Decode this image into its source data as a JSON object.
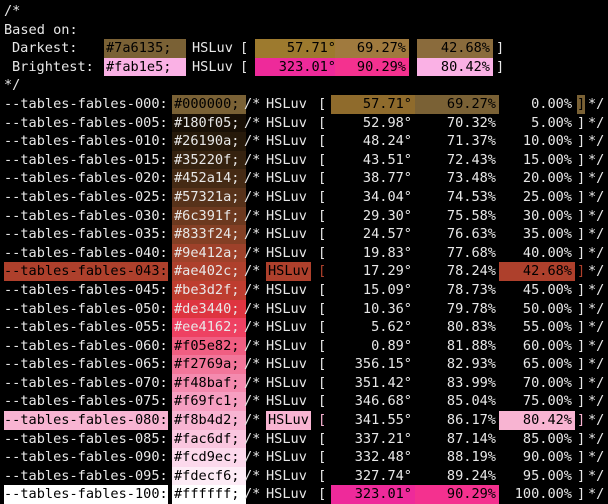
{
  "header": {
    "comment_open": "/*",
    "based_on": "Based on:",
    "darkest": {
      "label": "Darkest:",
      "hex": "#7a6135;",
      "hsluv": "HSLuv",
      "open": "[",
      "h": "57.71°",
      "s": "69.27%",
      "l": "42.68%",
      "close": "]",
      "color": "#7a6135",
      "text_color": "#000000"
    },
    "brightest": {
      "label": "Brightest:",
      "hex": "#fab1e5;",
      "hsluv": "HSLuv",
      "open": "[",
      "h": "323.01°",
      "s": "90.29%",
      "l": "80.42%",
      "close": "]",
      "color": "#fab1e5",
      "text_color": "#000000"
    },
    "comment_close": "*/"
  },
  "hsl_swatches": {
    "h_base": "#9d7a2e",
    "s_base": "#a07a3e",
    "l_base": "#8a6b3c",
    "h_bright": "#ee2a9a",
    "s_bright": "#f4318f",
    "l_bright": "#fab1e5"
  },
  "rows": [
    {
      "name": "--tables-fables-000:",
      "hex": "#000000;",
      "open": "/*",
      "hsluv": "HSLuv",
      "lb": "[",
      "h": "57.71°",
      "s": "69.27%",
      "l": "0.00%",
      "rb": "]",
      "end": "*/",
      "color": "#000000",
      "name_hl": "#000000",
      "name_fg": "#e8e8e8",
      "hsluv_hl": "",
      "boxed": true,
      "hex_bg": "#7a6135"
    },
    {
      "name": "--tables-fables-005:",
      "hex": "#180f05;",
      "open": "/*",
      "hsluv": "HSLuv",
      "lb": "[",
      "h": "52.98°",
      "s": "70.32%",
      "l": "5.00%",
      "rb": "]",
      "end": "*/",
      "color": "#180f05",
      "name_hl": "",
      "name_fg": "#e8e8e8",
      "hsluv_hl": ""
    },
    {
      "name": "--tables-fables-010:",
      "hex": "#26190a;",
      "open": "/*",
      "hsluv": "HSLuv",
      "lb": "[",
      "h": "48.24°",
      "s": "71.37%",
      "l": "10.00%",
      "rb": "]",
      "end": "*/",
      "color": "#26190a",
      "name_hl": "",
      "name_fg": "#e8e8e8",
      "hsluv_hl": ""
    },
    {
      "name": "--tables-fables-015:",
      "hex": "#35220f;",
      "open": "/*",
      "hsluv": "HSLuv",
      "lb": "[",
      "h": "43.51°",
      "s": "72.43%",
      "l": "15.00%",
      "rb": "]",
      "end": "*/",
      "color": "#35220f",
      "name_hl": "",
      "name_fg": "#e8e8e8",
      "hsluv_hl": ""
    },
    {
      "name": "--tables-fables-020:",
      "hex": "#452a14;",
      "open": "/*",
      "hsluv": "HSLuv",
      "lb": "[",
      "h": "38.77°",
      "s": "73.48%",
      "l": "20.00%",
      "rb": "]",
      "end": "*/",
      "color": "#452a14",
      "name_hl": "",
      "name_fg": "#e8e8e8",
      "hsluv_hl": ""
    },
    {
      "name": "--tables-fables-025:",
      "hex": "#57321a;",
      "open": "/*",
      "hsluv": "HSLuv",
      "lb": "[",
      "h": "34.04°",
      "s": "74.53%",
      "l": "25.00%",
      "rb": "]",
      "end": "*/",
      "color": "#57321a",
      "name_hl": "",
      "name_fg": "#e8e8e8",
      "hsluv_hl": ""
    },
    {
      "name": "--tables-fables-030:",
      "hex": "#6c391f;",
      "open": "/*",
      "hsluv": "HSLuv",
      "lb": "[",
      "h": "29.30°",
      "s": "75.58%",
      "l": "30.00%",
      "rb": "]",
      "end": "*/",
      "color": "#6c391f",
      "name_hl": "",
      "name_fg": "#e8e8e8",
      "hsluv_hl": ""
    },
    {
      "name": "--tables-fables-035:",
      "hex": "#833f24;",
      "open": "/*",
      "hsluv": "HSLuv",
      "lb": "[",
      "h": "24.57°",
      "s": "76.63%",
      "l": "35.00%",
      "rb": "]",
      "end": "*/",
      "color": "#833f24",
      "name_hl": "",
      "name_fg": "#e8e8e8",
      "hsluv_hl": ""
    },
    {
      "name": "--tables-fables-040:",
      "hex": "#9e412a;",
      "open": "/*",
      "hsluv": "HSLuv",
      "lb": "[",
      "h": "19.83°",
      "s": "77.68%",
      "l": "40.00%",
      "rb": "]",
      "end": "*/",
      "color": "#9e412a",
      "name_hl": "",
      "name_fg": "#e8e8e8",
      "hsluv_hl": ""
    },
    {
      "name": "--tables-fables-043:",
      "hex": "#ae402c;",
      "open": "/*",
      "hsluv": "HSLuv",
      "lb": "[",
      "h": "17.29°",
      "s": "78.24%",
      "l": "42.68%",
      "rb": "]",
      "end": "*/",
      "color": "#ae402c",
      "name_hl": "#ae402c",
      "name_fg": "#000000",
      "hsluv_hl": "#ae402c",
      "l_hl": "#ae402c",
      "rb_hl": "#ae402c"
    },
    {
      "name": "--tables-fables-045:",
      "hex": "#be3d2f;",
      "open": "/*",
      "hsluv": "HSLuv",
      "lb": "[",
      "h": "15.09°",
      "s": "78.73%",
      "l": "45.00%",
      "rb": "]",
      "end": "*/",
      "color": "#be3d2f",
      "name_hl": "",
      "name_fg": "#e8e8e8",
      "hsluv_hl": ""
    },
    {
      "name": "--tables-fables-050:",
      "hex": "#de3440;",
      "open": "/*",
      "hsluv": "HSLuv",
      "lb": "[",
      "h": "10.36°",
      "s": "79.78%",
      "l": "50.00%",
      "rb": "]",
      "end": "*/",
      "color": "#de3440",
      "name_hl": "",
      "name_fg": "#e8e8e8",
      "hsluv_hl": ""
    },
    {
      "name": "--tables-fables-055:",
      "hex": "#ee4162;",
      "open": "/*",
      "hsluv": "HSLuv",
      "lb": "[",
      "h": "5.62°",
      "s": "80.83%",
      "l": "55.00%",
      "rb": "]",
      "end": "*/",
      "color": "#ee4162",
      "name_hl": "",
      "name_fg": "#e8e8e8",
      "hsluv_hl": ""
    },
    {
      "name": "--tables-fables-060:",
      "hex": "#f05e82;",
      "open": "/*",
      "hsluv": "HSLuv",
      "lb": "[",
      "h": "0.89°",
      "s": "81.88%",
      "l": "60.00%",
      "rb": "]",
      "end": "*/",
      "color": "#f05e82",
      "name_hl": "",
      "name_fg": "#e8e8e8",
      "hsluv_hl": ""
    },
    {
      "name": "--tables-fables-065:",
      "hex": "#f2769a;",
      "open": "/*",
      "hsluv": "HSLuv",
      "lb": "[",
      "h": "356.15°",
      "s": "82.93%",
      "l": "65.00%",
      "rb": "]",
      "end": "*/",
      "color": "#f2769a",
      "name_hl": "",
      "name_fg": "#e8e8e8",
      "hsluv_hl": ""
    },
    {
      "name": "--tables-fables-070:",
      "hex": "#f48baf;",
      "open": "/*",
      "hsluv": "HSLuv",
      "lb": "[",
      "h": "351.42°",
      "s": "83.99%",
      "l": "70.00%",
      "rb": "]",
      "end": "*/",
      "color": "#f48baf",
      "name_hl": "",
      "name_fg": "#e8e8e8",
      "hsluv_hl": ""
    },
    {
      "name": "--tables-fables-075:",
      "hex": "#f69fc1;",
      "open": "/*",
      "hsluv": "HSLuv",
      "lb": "[",
      "h": "346.68°",
      "s": "85.04%",
      "l": "75.00%",
      "rb": "]",
      "end": "*/",
      "color": "#f69fc1",
      "name_hl": "",
      "name_fg": "#e8e8e8",
      "hsluv_hl": ""
    },
    {
      "name": "--tables-fables-080:",
      "hex": "#f8b4d2;",
      "open": "/*",
      "hsluv": "HSLuv",
      "lb": "[",
      "h": "341.55°",
      "s": "86.17%",
      "l": "80.42%",
      "rb": "]",
      "end": "*/",
      "color": "#f8b4d2",
      "name_hl": "#f8b4d2",
      "name_fg": "#000000",
      "hsluv_hl": "#f8b4d2",
      "l_hl": "#f8b4d2",
      "rb_hl": "#f8b4d2"
    },
    {
      "name": "--tables-fables-085:",
      "hex": "#fac6df;",
      "open": "/*",
      "hsluv": "HSLuv",
      "lb": "[",
      "h": "337.21°",
      "s": "87.14%",
      "l": "85.00%",
      "rb": "]",
      "end": "*/",
      "color": "#fac6df",
      "name_hl": "",
      "name_fg": "#e8e8e8",
      "hsluv_hl": ""
    },
    {
      "name": "--tables-fables-090:",
      "hex": "#fcd9ec;",
      "open": "/*",
      "hsluv": "HSLuv",
      "lb": "[",
      "h": "332.48°",
      "s": "88.19%",
      "l": "90.00%",
      "rb": "]",
      "end": "*/",
      "color": "#fcd9ec",
      "name_hl": "",
      "name_fg": "#e8e8e8",
      "hsluv_hl": ""
    },
    {
      "name": "--tables-fables-095:",
      "hex": "#fdecf6;",
      "open": "/*",
      "hsluv": "HSLuv",
      "lb": "[",
      "h": "327.74°",
      "s": "89.24%",
      "l": "95.00%",
      "rb": "]",
      "end": "*/",
      "color": "#fdecf6",
      "name_hl": "",
      "name_fg": "#e8e8e8",
      "hsluv_hl": ""
    },
    {
      "name": "--tables-fables-100:",
      "hex": "#ffffff;",
      "open": "/*",
      "hsluv": "HSLuv",
      "lb": "[",
      "h": "323.01°",
      "s": "90.29%",
      "l": "100.00%",
      "rb": "]",
      "end": "*/",
      "color": "#ffffff",
      "name_hl": "#ffffff",
      "name_fg": "#000000",
      "hsluv_hl": "",
      "boxed_light": true
    }
  ]
}
